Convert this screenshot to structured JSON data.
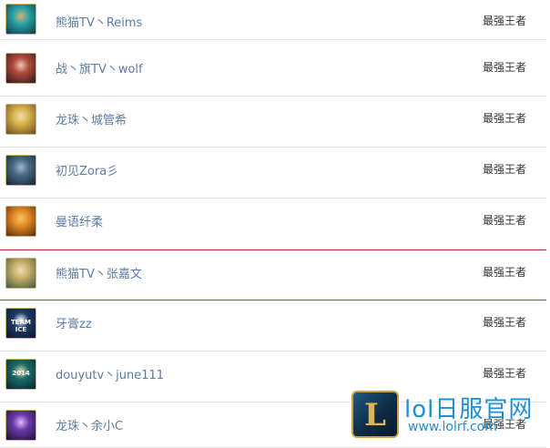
{
  "players": [
    {
      "name": "熊猫TV丶Reims",
      "rank": "最强王者",
      "avatar_icon": "teal-spirit-avatar-icon",
      "avatar_colors": [
        "#2aa3a8",
        "#0d3a44",
        "#d6b36a"
      ]
    },
    {
      "name": "战丶旗TV丶wolf",
      "rank": "最强王者",
      "avatar_icon": "tophat-champion-avatar-icon",
      "avatar_colors": [
        "#b04a3a",
        "#2b1a1a",
        "#e9c6b0"
      ]
    },
    {
      "name": "龙珠丶城管希",
      "rank": "最强王者",
      "avatar_icon": "blonde-champion-avatar-icon",
      "avatar_colors": [
        "#d8b24a",
        "#6b4a22",
        "#f1dfb0"
      ]
    },
    {
      "name": "初见Zora彡",
      "rank": "最强王者",
      "avatar_icon": "emblem-shield-avatar-icon",
      "avatar_colors": [
        "#4a6a86",
        "#18232e",
        "#9fb7c9"
      ]
    },
    {
      "name": "曼语纤柔",
      "rank": "最强王者",
      "avatar_icon": "orange-chest-avatar-icon",
      "avatar_colors": [
        "#e28a22",
        "#5a2a12",
        "#f5c66a"
      ]
    },
    {
      "name": "熊猫TV丶张嘉文",
      "rank": "最强王者",
      "avatar_icon": "blonde-champion-avatar-icon",
      "avatar_colors": [
        "#c9b06a",
        "#3f5a3a",
        "#efe2b8"
      ]
    },
    {
      "name": "牙膏zz",
      "rank": "最强王者",
      "avatar_icon": "team-ice-avatar-icon",
      "avatar_colors": [
        "#1d3a66",
        "#0b1730",
        "#ffffff"
      ],
      "avatar_text": "TEAM ICE"
    },
    {
      "name": "douyutv丶june111",
      "rank": "最强王者",
      "avatar_icon": "crest-2014-avatar-icon",
      "avatar_colors": [
        "#1a6a6a",
        "#0b2424",
        "#e5d7a2"
      ],
      "avatar_text": "2014"
    },
    {
      "name": "龙珠丶余小C",
      "rank": "最强王者",
      "avatar_icon": "purple-champion-avatar-icon",
      "avatar_colors": [
        "#6a3aa8",
        "#1c0f33",
        "#e6b6ff"
      ]
    }
  ],
  "watermark": {
    "logo_letter": "L",
    "title": "lol日服官网",
    "url": "www.lolrf.com",
    "logo_color": "#d9b45a",
    "text_color": "#1f8fd6"
  },
  "colors": {
    "name_link": "#5c7ca5",
    "highlight_border": "#c0392b",
    "row_divider": "#e8e8e8"
  }
}
